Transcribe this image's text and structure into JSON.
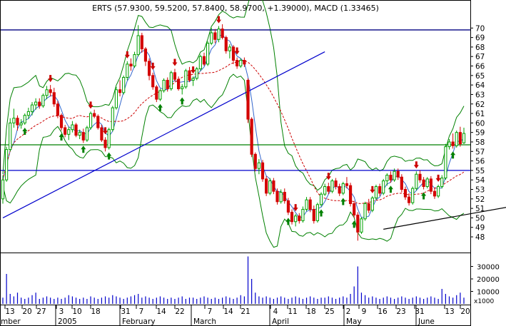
{
  "chart_data": {
    "type": "candlestick",
    "title": "ERTS (57.9300, 59.5200, 57.8400, 58.9700, +1.39000), MACD (1.33465)",
    "price_axis": {
      "ylim": [
        46.5,
        71.3
      ],
      "ticks": [
        48,
        49,
        50,
        51,
        52,
        53,
        54,
        55,
        56,
        57,
        58,
        59,
        60,
        61,
        62,
        63,
        64,
        65,
        66,
        67,
        68,
        69,
        70
      ]
    },
    "volume_axis": {
      "ylim": [
        0,
        40000
      ],
      "ticks": [
        "10000",
        "20000",
        "30000"
      ],
      "unit_label": "x1000"
    },
    "x_axis": {
      "day_labels": [
        "13",
        "20",
        "27",
        "3",
        "10",
        "18",
        "31",
        "7",
        "14",
        "22",
        "7",
        "14",
        "21",
        "4",
        "11",
        "18",
        "25",
        "2",
        "9",
        "16",
        "23",
        "31",
        "13",
        "20"
      ],
      "month_labels": [
        "mber",
        "2005",
        "February",
        "March",
        "April",
        "May",
        "June"
      ]
    },
    "horizontal_lines": [
      {
        "name": "resistance",
        "y": 69.8,
        "color": "#000080"
      },
      {
        "name": "support-green",
        "y": 57.7,
        "color": "#008000"
      },
      {
        "name": "mid-blue",
        "y": 55.0,
        "color": "#0000cc"
      }
    ],
    "trendlines": [
      {
        "name": "uptrend-1",
        "color": "#0000cc",
        "from_index": 0,
        "from_y": 50.0,
        "to_index": 88,
        "to_y": 67.5
      },
      {
        "name": "uptrend-2",
        "color": "#000000",
        "from_index": 104,
        "from_y": 48.8,
        "to_index": 168,
        "to_y": 53.2
      }
    ],
    "candles": [
      [
        52.0,
        54.5,
        51.5,
        54.0
      ],
      [
        54.0,
        57.5,
        53.8,
        57.2
      ],
      [
        57.2,
        60.5,
        57.0,
        60.0
      ],
      [
        60.0,
        61.5,
        59.5,
        60.5
      ],
      [
        60.5,
        60.8,
        59.2,
        59.8
      ],
      [
        59.8,
        60.4,
        59.4,
        60.0
      ],
      [
        60.0,
        61.0,
        59.8,
        60.8
      ],
      [
        60.8,
        61.6,
        60.4,
        61.2
      ],
      [
        61.2,
        62.2,
        60.8,
        61.9
      ],
      [
        61.9,
        62.6,
        61.4,
        62.2
      ],
      [
        62.2,
        62.6,
        61.5,
        61.8
      ],
      [
        61.8,
        63.1,
        61.6,
        62.9
      ],
      [
        62.9,
        63.9,
        62.5,
        63.5
      ],
      [
        63.5,
        64.0,
        62.8,
        63.2
      ],
      [
        63.2,
        63.7,
        61.7,
        62.0
      ],
      [
        62.0,
        62.3,
        60.5,
        60.8
      ],
      [
        60.8,
        61.0,
        59.2,
        59.5
      ],
      [
        59.5,
        59.8,
        58.5,
        58.8
      ],
      [
        58.8,
        59.6,
        58.2,
        59.3
      ],
      [
        59.3,
        60.2,
        59.0,
        59.8
      ],
      [
        59.8,
        60.0,
        58.5,
        58.7
      ],
      [
        58.7,
        59.3,
        58.3,
        59.0
      ],
      [
        59.0,
        59.4,
        57.9,
        58.2
      ],
      [
        58.2,
        59.7,
        58.0,
        59.5
      ],
      [
        59.5,
        61.2,
        59.3,
        61.0
      ],
      [
        61.0,
        61.4,
        60.5,
        60.7
      ],
      [
        60.7,
        60.9,
        59.3,
        59.5
      ],
      [
        59.5,
        59.8,
        58.0,
        58.2
      ],
      [
        58.2,
        58.5,
        57.0,
        57.4
      ],
      [
        57.4,
        59.5,
        57.2,
        59.3
      ],
      [
        59.3,
        61.8,
        59.1,
        61.6
      ],
      [
        61.6,
        63.8,
        61.4,
        63.5
      ],
      [
        63.5,
        64.5,
        62.8,
        63.2
      ],
      [
        63.2,
        65.0,
        63.0,
        64.8
      ],
      [
        64.8,
        66.5,
        64.5,
        66.2
      ],
      [
        66.2,
        66.8,
        65.5,
        66.0
      ],
      [
        66.0,
        67.5,
        65.8,
        67.2
      ],
      [
        67.2,
        70.3,
        67.0,
        69.2
      ],
      [
        69.2,
        69.5,
        67.4,
        67.8
      ],
      [
        67.8,
        68.0,
        66.0,
        66.5
      ],
      [
        66.5,
        66.8,
        64.5,
        65.0
      ],
      [
        65.0,
        65.3,
        63.5,
        63.8
      ],
      [
        63.8,
        64.0,
        62.2,
        62.5
      ],
      [
        62.5,
        63.6,
        62.3,
        63.4
      ],
      [
        63.4,
        64.7,
        63.2,
        64.5
      ],
      [
        64.5,
        64.8,
        63.3,
        63.6
      ],
      [
        63.6,
        65.5,
        63.4,
        65.3
      ],
      [
        65.3,
        65.7,
        64.4,
        64.6
      ],
      [
        64.6,
        64.9,
        63.4,
        63.6
      ],
      [
        63.6,
        64.1,
        63.0,
        63.8
      ],
      [
        63.8,
        65.7,
        63.6,
        65.5
      ],
      [
        65.5,
        65.9,
        64.3,
        64.5
      ],
      [
        64.5,
        64.9,
        63.9,
        64.7
      ],
      [
        64.7,
        65.9,
        64.5,
        65.7
      ],
      [
        65.7,
        67.2,
        65.5,
        67.0
      ],
      [
        67.0,
        67.4,
        66.0,
        66.2
      ],
      [
        66.2,
        68.6,
        66.0,
        68.4
      ],
      [
        68.4,
        70.0,
        68.2,
        69.5
      ],
      [
        69.5,
        69.9,
        68.4,
        68.8
      ],
      [
        68.8,
        70.2,
        68.5,
        69.9
      ],
      [
        69.9,
        70.4,
        68.8,
        69.0
      ],
      [
        69.0,
        69.2,
        67.3,
        67.6
      ],
      [
        67.6,
        68.3,
        66.8,
        68.0
      ],
      [
        68.0,
        68.2,
        66.2,
        66.6
      ],
      [
        66.6,
        66.9,
        65.7,
        66.0
      ],
      [
        66.0,
        66.8,
        65.8,
        66.6
      ],
      [
        66.6,
        66.9,
        65.9,
        66.2
      ],
      [
        64.5,
        64.7,
        60.0,
        60.4
      ],
      [
        60.4,
        60.6,
        56.4,
        56.7
      ],
      [
        56.7,
        56.9,
        54.9,
        55.2
      ],
      [
        55.2,
        56.2,
        54.6,
        55.8
      ],
      [
        55.8,
        56.1,
        53.8,
        54.1
      ],
      [
        54.1,
        54.4,
        52.3,
        52.6
      ],
      [
        52.6,
        54.2,
        52.4,
        53.9
      ],
      [
        53.9,
        54.2,
        52.5,
        52.8
      ],
      [
        52.8,
        53.1,
        51.4,
        51.7
      ],
      [
        51.7,
        53.0,
        51.5,
        52.7
      ],
      [
        52.7,
        53.1,
        51.5,
        51.8
      ],
      [
        51.8,
        52.1,
        50.3,
        50.6
      ],
      [
        50.6,
        50.9,
        49.3,
        49.6
      ],
      [
        49.6,
        50.4,
        49.1,
        50.2
      ],
      [
        50.2,
        50.5,
        49.4,
        49.7
      ],
      [
        49.7,
        51.2,
        49.5,
        50.9
      ],
      [
        50.9,
        52.2,
        50.7,
        51.9
      ],
      [
        51.9,
        52.2,
        50.6,
        50.9
      ],
      [
        50.9,
        51.3,
        49.4,
        49.7
      ],
      [
        49.7,
        51.6,
        49.5,
        51.4
      ],
      [
        51.4,
        52.7,
        51.2,
        52.5
      ],
      [
        52.5,
        53.6,
        52.3,
        53.3
      ],
      [
        53.3,
        53.7,
        52.5,
        52.8
      ],
      [
        52.8,
        54.1,
        52.6,
        53.9
      ],
      [
        53.9,
        54.2,
        53.0,
        53.3
      ],
      [
        53.3,
        53.6,
        52.3,
        52.6
      ],
      [
        52.6,
        53.8,
        52.4,
        53.6
      ],
      [
        53.6,
        54.3,
        53.1,
        53.4
      ],
      [
        53.4,
        53.7,
        51.2,
        51.5
      ],
      [
        51.5,
        51.8,
        50.0,
        50.3
      ],
      [
        50.3,
        50.6,
        47.6,
        48.5
      ],
      [
        48.5,
        50.1,
        48.3,
        49.9
      ],
      [
        49.9,
        51.7,
        49.7,
        51.5
      ],
      [
        51.5,
        52.0,
        50.5,
        50.8
      ],
      [
        50.8,
        52.3,
        50.6,
        52.1
      ],
      [
        52.1,
        53.5,
        51.9,
        53.3
      ],
      [
        53.3,
        53.6,
        52.3,
        52.6
      ],
      [
        52.6,
        54.1,
        52.4,
        53.9
      ],
      [
        53.9,
        54.7,
        53.4,
        54.5
      ],
      [
        54.5,
        54.9,
        53.7,
        54.0
      ],
      [
        54.0,
        55.2,
        53.8,
        54.9
      ],
      [
        54.9,
        55.2,
        54.0,
        54.3
      ],
      [
        54.3,
        54.6,
        52.7,
        53.0
      ],
      [
        53.0,
        53.3,
        51.9,
        52.2
      ],
      [
        52.2,
        52.6,
        51.3,
        51.6
      ],
      [
        51.6,
        53.3,
        51.4,
        53.1
      ],
      [
        53.1,
        54.9,
        52.9,
        54.6
      ],
      [
        54.6,
        55.0,
        53.7,
        54.0
      ],
      [
        54.0,
        54.3,
        53.0,
        53.3
      ],
      [
        53.3,
        54.3,
        53.1,
        54.1
      ],
      [
        54.1,
        54.4,
        52.5,
        52.8
      ],
      [
        52.8,
        53.1,
        52.0,
        52.3
      ],
      [
        52.3,
        53.5,
        52.1,
        53.3
      ],
      [
        53.3,
        54.5,
        53.1,
        54.2
      ],
      [
        54.2,
        57.8,
        54.0,
        57.5
      ],
      [
        57.5,
        58.3,
        57.2,
        58.0
      ],
      [
        58.0,
        58.9,
        57.3,
        57.6
      ],
      [
        57.6,
        59.2,
        57.4,
        59.0
      ],
      [
        59.0,
        59.6,
        57.5,
        57.8
      ],
      [
        57.9,
        59.5,
        57.8,
        58.9
      ]
    ],
    "signals": {
      "down": [
        13,
        24,
        28,
        34,
        41,
        47,
        52,
        59,
        64,
        80,
        89,
        101,
        113,
        119
      ],
      "up": [
        6,
        16,
        22,
        29,
        43,
        49,
        78,
        87,
        93,
        96,
        106,
        115,
        123
      ]
    },
    "colors": {
      "up_candle": "#00a000",
      "down_candle": "#d40000",
      "bollinger": "#008000",
      "ma_short": "#3366cc",
      "ma_long_dashed": "#cc0000",
      "signal_up": "#008000",
      "signal_down": "#cc0000"
    },
    "volume": [
      5,
      24,
      8,
      6,
      9,
      5,
      4,
      5,
      7,
      9,
      4,
      5,
      6,
      5,
      4,
      5,
      4,
      5,
      7,
      6,
      5,
      4,
      5,
      4,
      6,
      5,
      4,
      5,
      6,
      5,
      7,
      6,
      5,
      4,
      5,
      6,
      7,
      8,
      5,
      6,
      5,
      4,
      5,
      6,
      5,
      4,
      5,
      4,
      5,
      6,
      4,
      5,
      5,
      4,
      5,
      6,
      5,
      4,
      5,
      4,
      5,
      6,
      5,
      4,
      5,
      7,
      6,
      38,
      20,
      9,
      6,
      5,
      6,
      5,
      4,
      5,
      6,
      5,
      4,
      5,
      6,
      5,
      4,
      5,
      6,
      5,
      4,
      5,
      5,
      6,
      5,
      4,
      5,
      6,
      5,
      8,
      14,
      30,
      9,
      7,
      5,
      6,
      5,
      4,
      5,
      6,
      5,
      4,
      5,
      6,
      5,
      4,
      5,
      6,
      5,
      4,
      5,
      6,
      5,
      4,
      12,
      8,
      6,
      5,
      7,
      9,
      5
    ]
  }
}
